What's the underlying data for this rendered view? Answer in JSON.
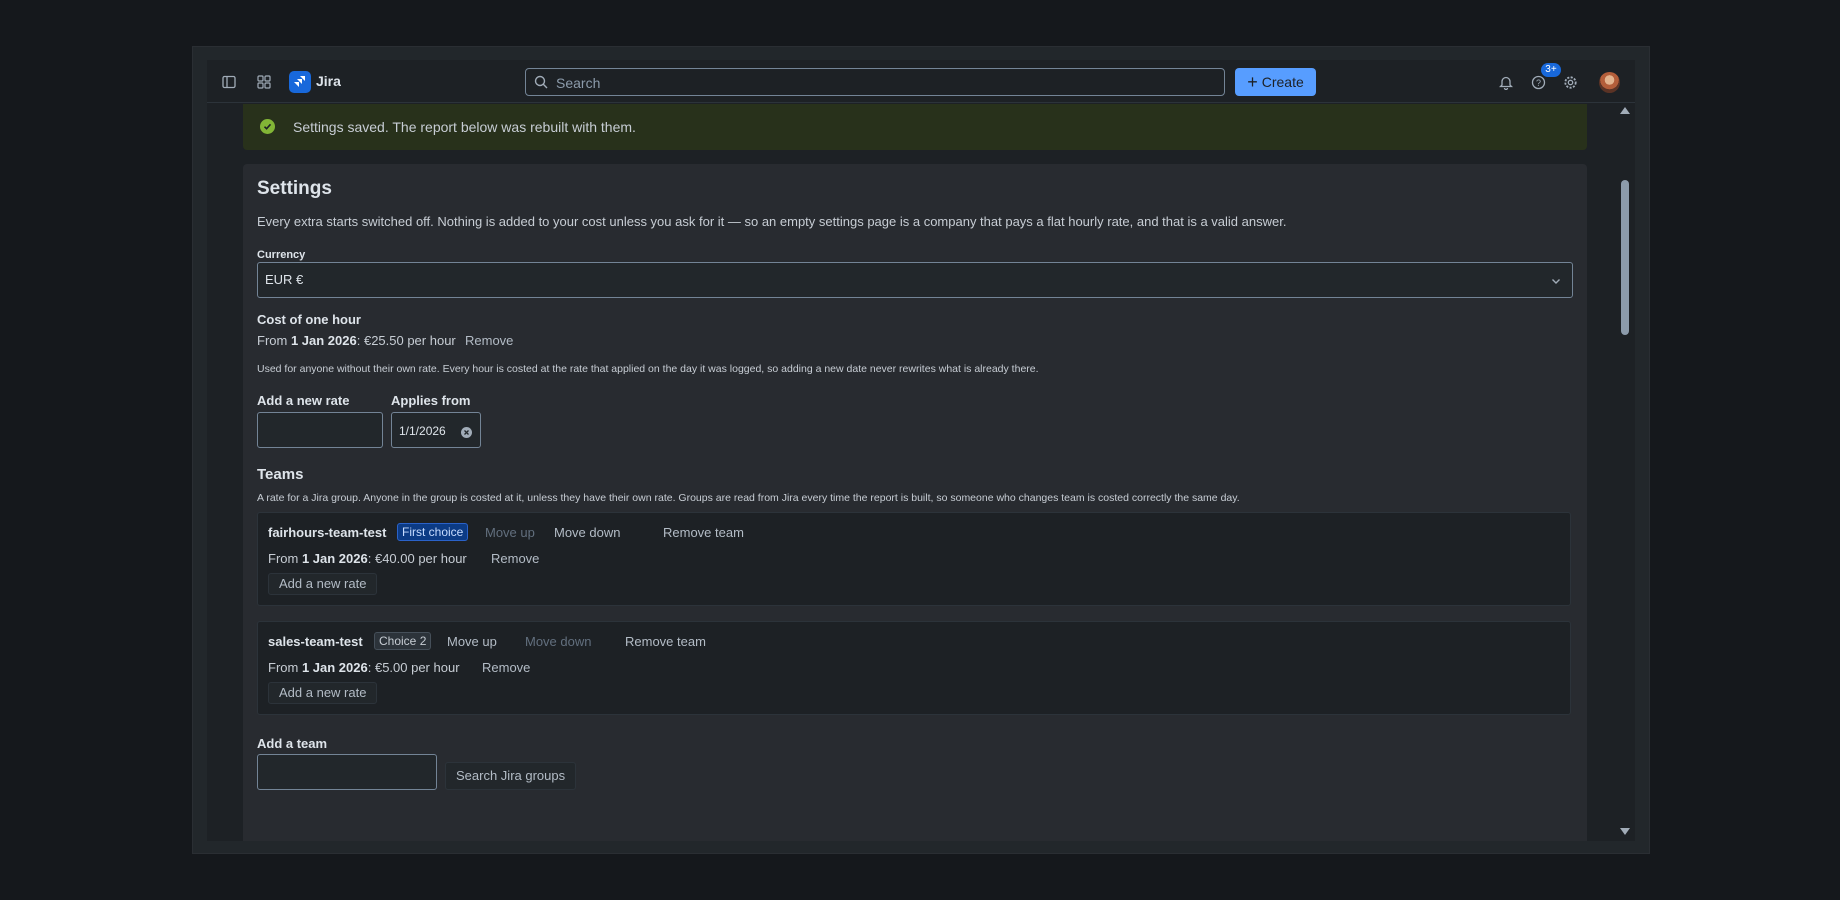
{
  "app": {
    "name": "Jira"
  },
  "search": {
    "placeholder": "Search"
  },
  "create_label": "Create",
  "notifications_badge": "3+",
  "banner": {
    "text": "Settings saved. The report below was rebuilt with them."
  },
  "settings": {
    "title": "Settings",
    "intro": "Every extra starts switched off. Nothing is added to your cost unless you ask for it — so an empty settings page is a company that pays a flat hourly rate, and that is a valid answer.",
    "currency": {
      "label": "Currency",
      "value": "EUR €"
    },
    "cost_of_hour": {
      "title": "Cost of one hour",
      "rate": {
        "prefix": "From ",
        "date": "1 Jan 2026",
        "suffix": ": €25.50 per hour",
        "remove": "Remove"
      },
      "description": "Used for anyone without their own rate. Every hour is costed at the rate that applied on the day it was logged, so adding a new date never rewrites what is already there.",
      "new_rate_label": "Add a new rate",
      "new_rate_value": "",
      "applies_from_label": "Applies from",
      "applies_from_value": "1/1/2026"
    },
    "teams": {
      "title": "Teams",
      "description": "A rate for a Jira group. Anyone in the group is costed at it, unless they have their own rate. Groups are read from Jira every time the report is built, so someone who changes team is costed correctly the same day.",
      "items": [
        {
          "name": "fairhours-team-test",
          "badge": "First choice",
          "move_up": "Move up",
          "move_down": "Move down",
          "remove_team": "Remove team",
          "rate": {
            "prefix": "From ",
            "date": "1 Jan 2026",
            "suffix": ": €40.00 per hour",
            "remove": "Remove"
          },
          "add_rate": "Add a new rate"
        },
        {
          "name": "sales-team-test",
          "badge": "Choice 2",
          "move_up": "Move up",
          "move_down": "Move down",
          "remove_team": "Remove team",
          "rate": {
            "prefix": "From ",
            "date": "1 Jan 2026",
            "suffix": ": €5.00 per hour",
            "remove": "Remove"
          },
          "add_rate": "Add a new rate"
        }
      ],
      "add_team_label": "Add a team",
      "add_team_value": "",
      "search_groups": "Search Jira groups"
    }
  },
  "colors": {
    "accent": "#579dff",
    "success": "#82b536",
    "banner_bg": "#28311b"
  }
}
